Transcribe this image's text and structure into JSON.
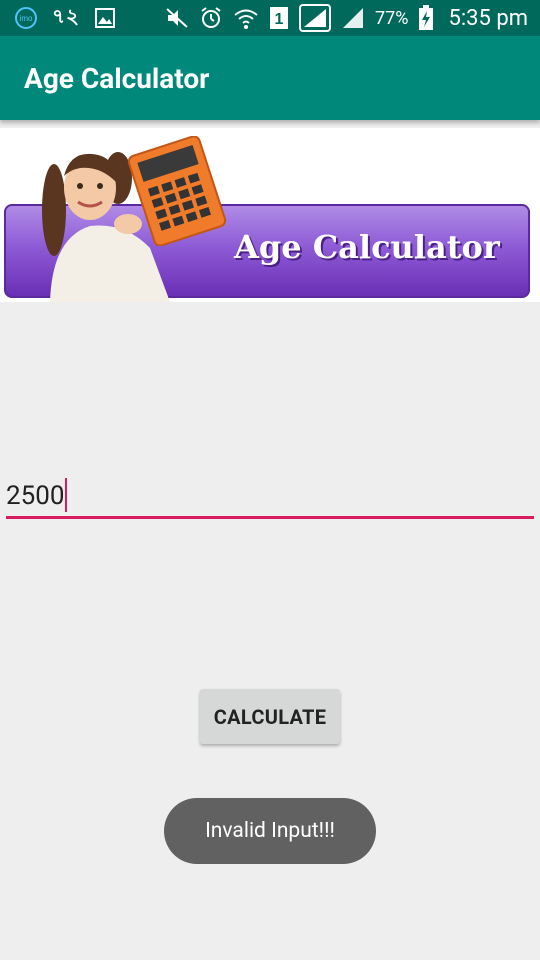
{
  "status_bar": {
    "left_icons": [
      "imo-icon",
      "bengali-digits",
      "gallery-icon"
    ],
    "bengali_digits": "৭২",
    "right_icons": [
      "mute-icon",
      "alarm-icon",
      "wifi-icon",
      "sim1-icon",
      "signal-icon",
      "signal2-icon",
      "battery-charging-icon"
    ],
    "sim_label": "1",
    "battery_percent": "77%",
    "time": "5:35 pm"
  },
  "app_bar": {
    "title": "Age Calculator",
    "color": "#00897b",
    "status_color": "#00695c"
  },
  "banner": {
    "text": "Age Calculator"
  },
  "age_input": {
    "value": "2500",
    "accent_color": "#d81b60"
  },
  "calculate_button": {
    "label": "CALCULATE"
  },
  "toast": {
    "message": "Invalid Input!!!"
  }
}
